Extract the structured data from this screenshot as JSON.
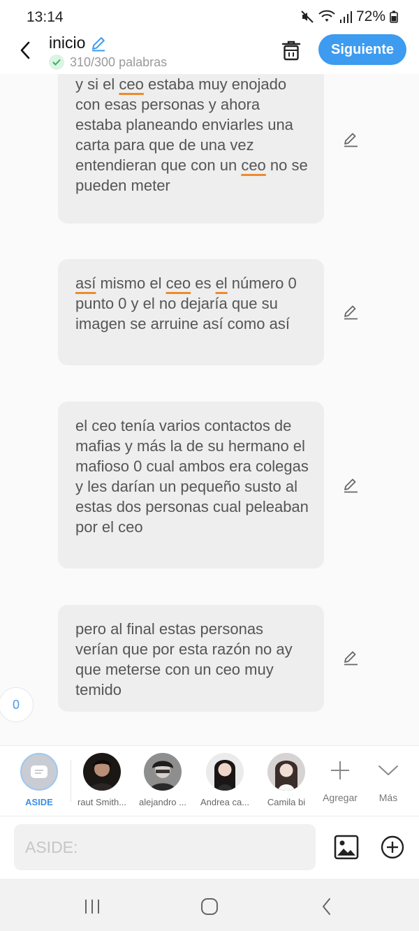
{
  "status": {
    "time": "13:14",
    "battery": "72%"
  },
  "header": {
    "title": "inicio",
    "word_count": "310/300 palabras",
    "next_label": "Siguiente"
  },
  "messages": [
    {
      "segments": [
        {
          "t": "y si el "
        },
        {
          "t": "ceo",
          "u": true
        },
        {
          "t": " estaba muy enojado con esas personas y ahora estaba planeando enviarles una carta para que de una vez entendieran que con un "
        },
        {
          "t": "ceo",
          "u": true
        },
        {
          "t": " no se pueden meter"
        }
      ]
    },
    {
      "segments": [
        {
          "t": "así",
          "u": true
        },
        {
          "t": " mismo el "
        },
        {
          "t": "ceo",
          "u": true
        },
        {
          "t": " es "
        },
        {
          "t": "el",
          "u": true
        },
        {
          "t": " número 0 punto 0 y el no dejaría que su imagen se arruine así como así"
        }
      ]
    },
    {
      "segments": [
        {
          "t": "el ceo tenía varios contactos de mafias y más la de su hermano el mafioso 0 cual ambos era colegas y les darían un pequeño susto al estas dos personas cual peleaban por el ceo"
        }
      ]
    },
    {
      "segments": [
        {
          "t": "pero al final estas personas verían que por esta razón no ay que meterse con un ceo muy temido"
        }
      ]
    }
  ],
  "counter": "0",
  "characters": {
    "aside": "ASIDE",
    "list": [
      "raut Smith...",
      "alejandro ...",
      "Andrea ca...",
      "Camila bi"
    ]
  },
  "actions": {
    "add": "Agregar",
    "more": "Más"
  },
  "input": {
    "placeholder": "ASIDE:"
  }
}
